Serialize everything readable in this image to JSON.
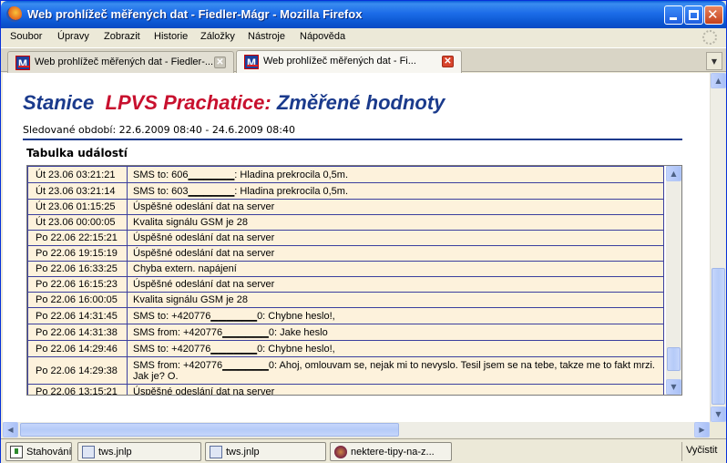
{
  "window": {
    "title": "Web prohlížeč měřených dat - Fiedler-Mágr - Mozilla Firefox"
  },
  "menu": [
    "Soubor",
    "Úpravy",
    "Zobrazit",
    "Historie",
    "Záložky",
    "Nástroje",
    "Nápověda"
  ],
  "tabs": [
    {
      "label": "Web prohlížeč měřených dat - Fiedler-...",
      "favicon": "M",
      "active": false
    },
    {
      "label": "Web prohlížeč měřených dat - Fi...",
      "favicon": "M",
      "active": true
    }
  ],
  "page": {
    "heading_station": "Stanice",
    "heading_name": "LPVS Prachatice:",
    "heading_suffix": "Změřené hodnoty",
    "period": "Sledované období: 22.6.2009 08:40 - 24.6.2009 08:40",
    "table_title": "Tabulka událostí",
    "events": [
      {
        "dt": "Út 23.06 03:21:21",
        "msg": "SMS to: 606▁▁▁▁▁▁: Hladina prekrocila 0,5m."
      },
      {
        "dt": "Út 23.06 03:21:14",
        "msg": "SMS to: 603▁▁▁▁▁▁: Hladina prekrocila 0,5m."
      },
      {
        "dt": "Út 23.06 01:15:25",
        "msg": "Úspěšné odeslání dat na server"
      },
      {
        "dt": "Út 23.06 00:00:05",
        "msg": "Kvalita signálu GSM je 28"
      },
      {
        "dt": "Po 22.06 22:15:21",
        "msg": "Úspěšné odeslání dat na server"
      },
      {
        "dt": "Po 22.06 19:15:19",
        "msg": "Úspěšné odeslání dat na server"
      },
      {
        "dt": "Po 22.06 16:33:25",
        "msg": "Chyba extern. napájení"
      },
      {
        "dt": "Po 22.06 16:15:23",
        "msg": "Úspěšné odeslání dat na server"
      },
      {
        "dt": "Po 22.06 16:00:05",
        "msg": "Kvalita signálu GSM je 28"
      },
      {
        "dt": "Po 22.06 14:31:45",
        "msg": "SMS to: +420776▁▁▁▁▁▁0: Chybne heslo!,"
      },
      {
        "dt": "Po 22.06 14:31:38",
        "msg": "SMS from: +420776▁▁▁▁▁▁0: Jake heslo"
      },
      {
        "dt": "Po 22.06 14:29:46",
        "msg": "SMS to: +420776▁▁▁▁▁▁0: Chybne heslo!,"
      },
      {
        "dt": "Po 22.06 14:29:38",
        "msg": "SMS from: +420776▁▁▁▁▁▁0: Ahoj, omlouvam se, nejak mi to nevyslo. Tesil jsem se na tebe, takze me to fakt mrzi. Jak je? O."
      },
      {
        "dt": "Po 22.06 13:15:21",
        "msg": "Úspěšné odeslání dat na server"
      }
    ]
  },
  "taskbar": {
    "items": [
      {
        "label": "Stahování",
        "icon": "download-icon"
      },
      {
        "label": "tws.jnlp",
        "icon": "file-icon"
      },
      {
        "label": "tws.jnlp",
        "icon": "file-icon"
      },
      {
        "label": "nektere-tipy-na-z...",
        "icon": "firefox-icon"
      }
    ],
    "clear_label": "Vyčistit"
  },
  "colors": {
    "heading_blue": "#1a3a8c",
    "heading_red": "#c8102e",
    "row_bg": "#fdf2dc",
    "row_border": "#3b3f9e"
  }
}
